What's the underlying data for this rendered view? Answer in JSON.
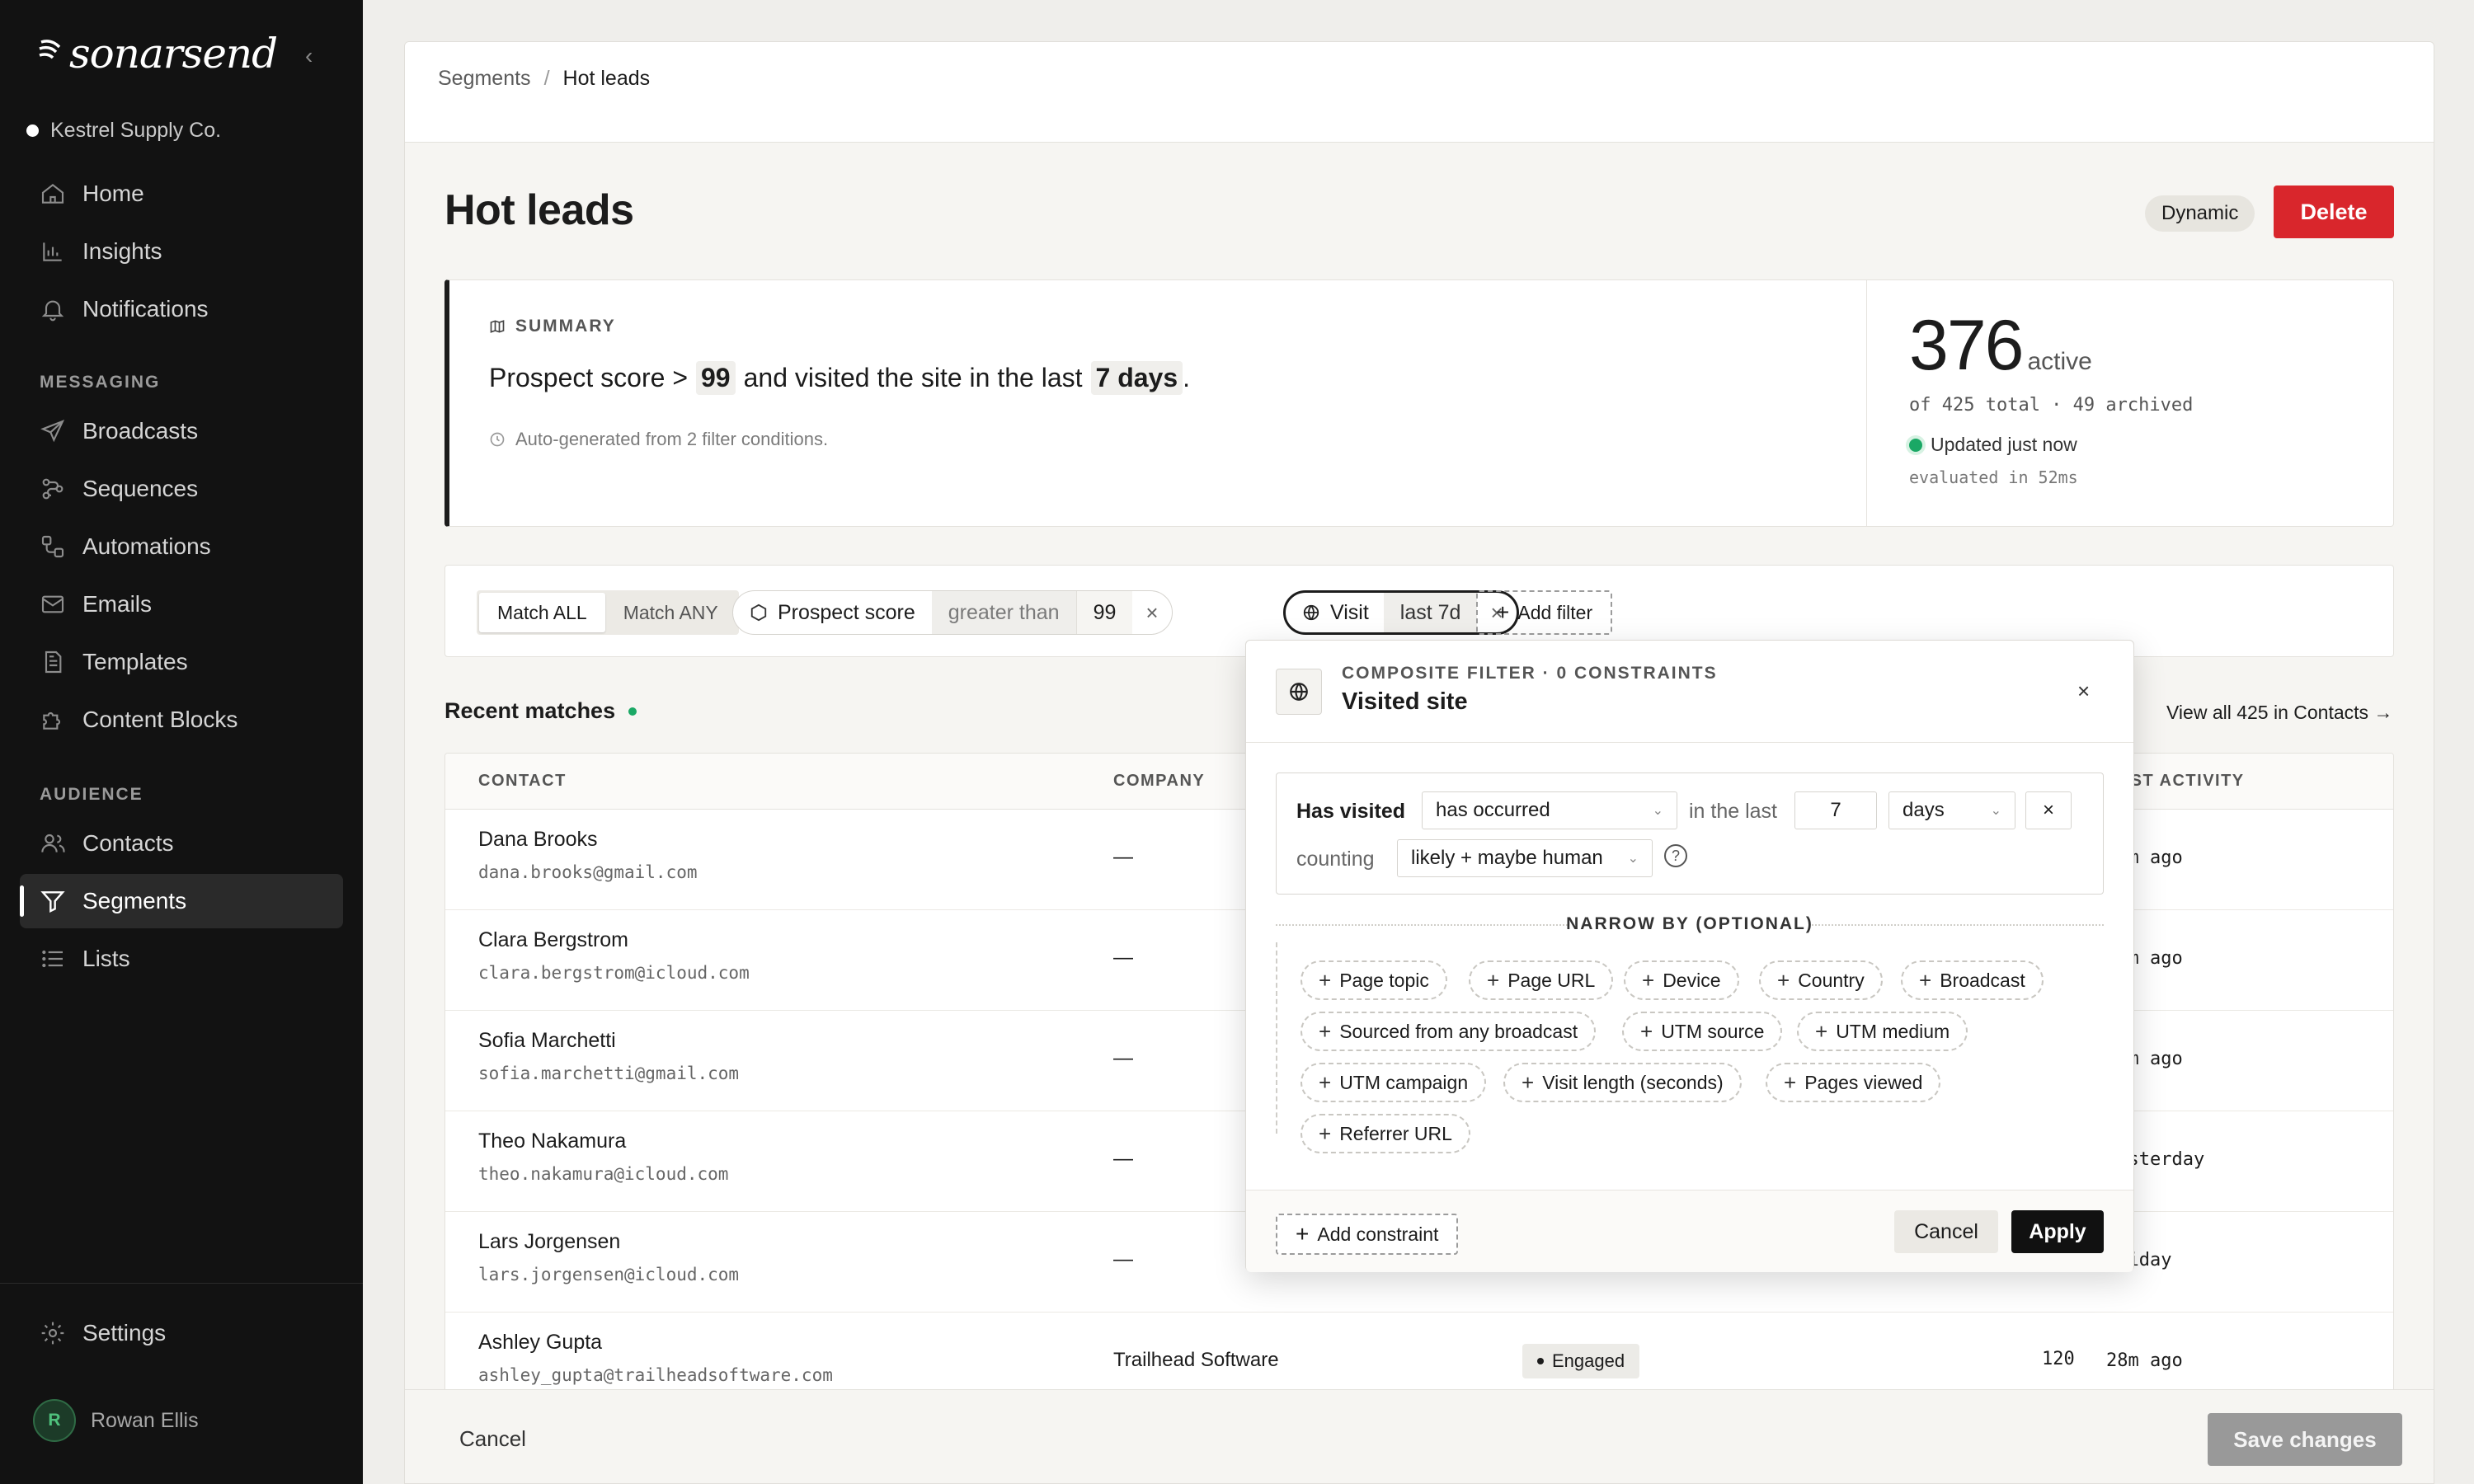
{
  "brand": {
    "name": "sonarsend",
    "org": "Kestrel Supply Co."
  },
  "nav": {
    "home": "Home",
    "insights": "Insights",
    "notifications": "Notifications",
    "messaging_label": "MESSAGING",
    "broadcasts": "Broadcasts",
    "sequences": "Sequences",
    "automations": "Automations",
    "emails": "Emails",
    "templates": "Templates",
    "content_blocks": "Content Blocks",
    "audience_label": "AUDIENCE",
    "contacts": "Contacts",
    "segments": "Segments",
    "lists": "Lists",
    "settings": "Settings"
  },
  "user": {
    "initial": "R",
    "name": "Rowan Ellis"
  },
  "breadcrumb": {
    "parent": "Segments",
    "sep": "/",
    "current": "Hot leads"
  },
  "page": {
    "title": "Hot leads",
    "badge": "Dynamic",
    "delete": "Delete"
  },
  "summary": {
    "label": "SUMMARY",
    "t1": "Prospect score >",
    "v1": "99",
    "t2": "and visited the site in the last",
    "v2": "7 days",
    "t3": ".",
    "note": "Auto-generated from 2 filter conditions."
  },
  "stats": {
    "active_count": "376",
    "active_label": "active",
    "of_total": "of 425 total · 49 archived",
    "updated": "Updated just now",
    "evaluated": "evaluated in 52ms"
  },
  "filters": {
    "match_all": "Match ALL",
    "match_any": "Match ANY",
    "chip1_field": "Prospect score",
    "chip1_op": "greater than",
    "chip1_val": "99",
    "chip2_field": "Visit",
    "chip2_val": "last 7d",
    "remove": "×",
    "add_filter": "Add filter"
  },
  "recent": {
    "title": "Recent matches",
    "view_all": "View all 425 in Contacts →"
  },
  "table": {
    "headers": {
      "contact": "CONTACT",
      "company": "COMPANY",
      "last_activity": "LAST ACTIVITY"
    },
    "rows": [
      {
        "name": "Dana Brooks",
        "email": "dana.brooks@gmail.com",
        "company": "—",
        "last": "31m ago"
      },
      {
        "name": "Clara Bergstrom",
        "email": "clara.bergstrom@icloud.com",
        "company": "—",
        "last": "30m ago"
      },
      {
        "name": "Sofia Marchetti",
        "email": "sofia.marchetti@gmail.com",
        "company": "—",
        "last": "29m ago"
      },
      {
        "name": "Theo Nakamura",
        "email": "theo.nakamura@icloud.com",
        "company": "—",
        "last": "Yesterday"
      },
      {
        "name": "Lars Jorgensen",
        "email": "lars.jorgensen@icloud.com",
        "company": "—",
        "last": "Friday"
      },
      {
        "name": "Ashley Gupta",
        "email": "ashley_gupta@trailheadsoftware.com",
        "company": "Trailhead Software",
        "status": "Engaged",
        "score": "120",
        "last": "28m ago"
      }
    ]
  },
  "footer": {
    "cancel": "Cancel",
    "save": "Save changes"
  },
  "popover": {
    "eyebrow": "COMPOSITE FILTER · 0 CONSTRAINTS",
    "title": "Visited site",
    "close": "×",
    "has_visited": "Has visited",
    "occurrence": "has occurred",
    "in_the_last": "in the last",
    "amount": "7",
    "unit": "days",
    "remove": "×",
    "counting": "counting",
    "human": "likely + maybe human",
    "help": "?",
    "narrow_label": "NARROW BY (OPTIONAL)",
    "narrow_options": [
      "Page topic",
      "Page URL",
      "Device",
      "Country",
      "Broadcast",
      "Sourced from any broadcast",
      "UTM source",
      "UTM medium",
      "UTM campaign",
      "Visit length (seconds)",
      "Pages viewed",
      "Referrer URL"
    ],
    "add_constraint": "Add constraint",
    "cancel": "Cancel",
    "apply": "Apply"
  }
}
